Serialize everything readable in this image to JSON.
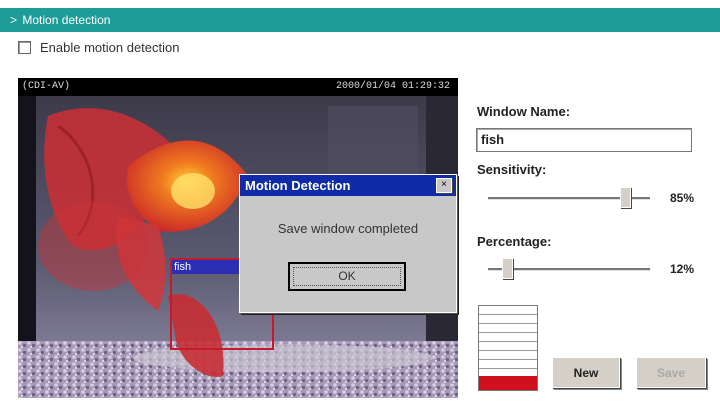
{
  "header": {
    "arrow": ">",
    "title": "Motion detection"
  },
  "enable": {
    "label": "Enable motion detection",
    "checked": false
  },
  "video": {
    "camera_label": "(CDI-AV)",
    "timestamp": "2000/01/04 01:29:32",
    "motion_window_name": "fish"
  },
  "dialog": {
    "title": "Motion Detection",
    "close_glyph": "×",
    "message": "Save window completed",
    "ok_label": "OK"
  },
  "panel": {
    "window_name_label": "Window Name:",
    "window_name_value": "fish",
    "sensitivity_label": "Sensitivity:",
    "sensitivity_value": 85,
    "sensitivity_text": "85%",
    "percentage_label": "Percentage:",
    "percentage_value": 12,
    "percentage_text": "12%",
    "activity_level": 0.17,
    "activity_color": "#d0101c",
    "new_label": "New",
    "save_label": "Save"
  },
  "colors": {
    "header_bg": "#1d9c98",
    "dialog_title": "#0f2ba8",
    "motion_window": "#c7192d"
  }
}
